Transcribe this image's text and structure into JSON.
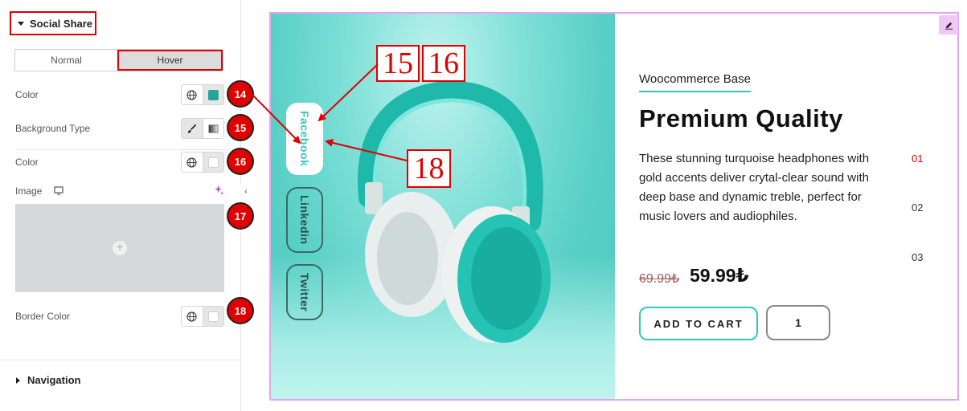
{
  "panel": {
    "section_title": "Social Share",
    "tabs": [
      {
        "label": "Normal"
      },
      {
        "label": "Hover"
      }
    ],
    "controls": {
      "color_label": "Color",
      "background_type_label": "Background Type",
      "color2_label": "Color",
      "image_label": "Image",
      "border_color_label": "Border Color"
    },
    "color_swatch": "#26a69a",
    "nav_section": "Navigation"
  },
  "annotations": {
    "badges": [
      "14",
      "15",
      "16",
      "17",
      "18"
    ],
    "callouts": [
      "15",
      "16",
      "18"
    ],
    "accent": "#e00000"
  },
  "preview": {
    "social": [
      "Facebook",
      "Linkedin",
      "Twitter"
    ],
    "subtitle": "Woocommerce Base",
    "title": "Premium Quality",
    "description": "These stunning turquoise headphones with gold accents deliver crytal-clear sound with deep base and dynamic treble, perfect for music lovers and audiophiles.",
    "indices": [
      "01",
      "02",
      "03"
    ],
    "old_price": "69.99₺",
    "new_price": "59.99₺",
    "cart_label": "ADD TO CART",
    "quantity": "1",
    "accent": "#2cc9bd"
  }
}
